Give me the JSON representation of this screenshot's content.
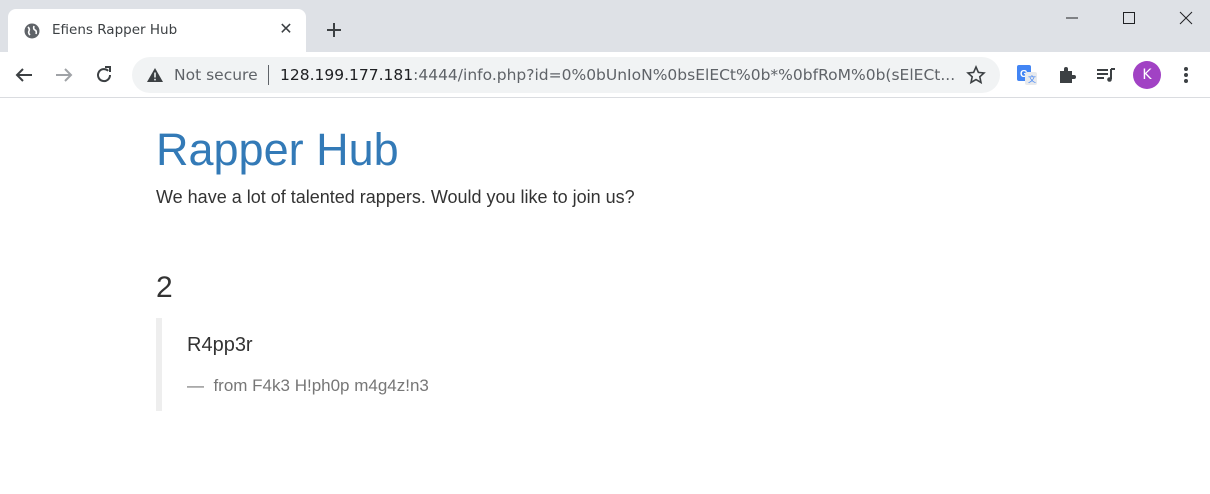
{
  "browser": {
    "tab_title": "Efiens Rapper Hub",
    "address": {
      "security_label": "Not secure",
      "host": "128.199.177.181",
      "path": ":4444/info.php?id=0%0bUnIoN%0bsElECt%0b*%0bfRoM%0b(sElECt..."
    },
    "profile_initial": "K",
    "colors": {
      "avatar": "#a142c4",
      "tabstrip": "#dee1e6"
    }
  },
  "page": {
    "title": "Rapper Hub",
    "lead": "We have a lot of talented rappers. Would you like to join us?",
    "result_number": "2",
    "quote": {
      "text": "R4pp3r",
      "dash": "—",
      "source": "from F4k3 H!ph0p m4g4z!n3"
    },
    "colors": {
      "title": "#337ab7",
      "text": "#333333",
      "muted": "#777777"
    }
  }
}
